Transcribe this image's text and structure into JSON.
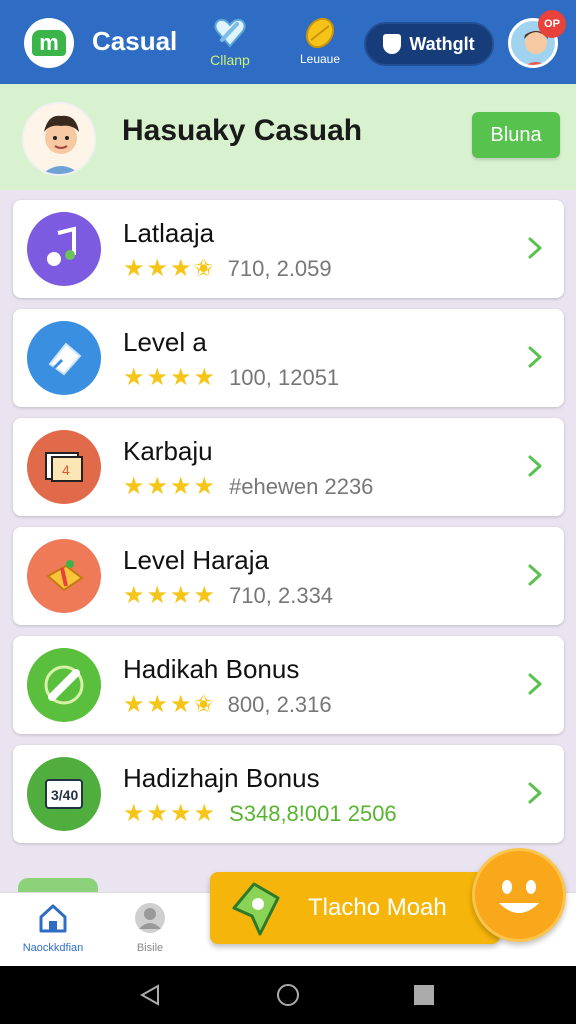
{
  "header": {
    "app_title": "Casual",
    "nav": [
      {
        "label": "Cllanp",
        "icon": "heart-icon"
      },
      {
        "label": "Leuaue",
        "icon": "ball-icon"
      }
    ],
    "watch_button": "Wathglt",
    "badge": "OP"
  },
  "hero": {
    "title": "Hasuaky Casuah",
    "button": "Bluna"
  },
  "items": [
    {
      "title": "Latlaaja",
      "rating": 3.5,
      "meta": "710, 2.059",
      "icon": "music-icon",
      "color": "#7d5be0"
    },
    {
      "title": "Level a",
      "rating": 4,
      "meta": "100, 12051",
      "icon": "bell-icon",
      "color": "#3a8fe0"
    },
    {
      "title": "Karbaju",
      "rating": 4,
      "meta": "#ehewen 2236",
      "icon": "photo-icon",
      "color": "#e06a4a"
    },
    {
      "title": "Level Haraja",
      "rating": 4,
      "meta": "710, 2.334",
      "icon": "gift-icon",
      "color": "#ee7a58"
    },
    {
      "title": "Hadikah Bonus",
      "rating": 3.5,
      "meta": "800, 2.316",
      "icon": "tool-icon",
      "color": "#5bbf3e"
    },
    {
      "title": "Hadizhajn Bonus",
      "rating": 4,
      "meta": "S348,8!001 2506",
      "icon": "scoreboard-icon",
      "color": "#4fae3d",
      "meta_green": true
    }
  ],
  "bottom_nav": [
    {
      "label": "Naockkdfian",
      "icon": "home-icon"
    },
    {
      "label": "Bisile",
      "icon": "profile-icon"
    }
  ],
  "cta": {
    "label": "Tlacho Moah",
    "icon": "map-pin-icon"
  },
  "colors": {
    "primary": "#2f6dc4",
    "accent": "#58c24e",
    "star": "#f5c518",
    "cta": "#f5b50a"
  }
}
